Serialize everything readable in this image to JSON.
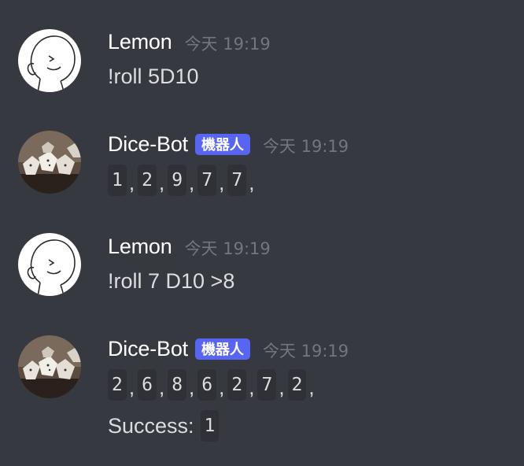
{
  "messages": [
    {
      "username": "Lemon",
      "timestamp": "今天 19:19",
      "content": "!roll 5D10",
      "avatar_icon": "sketch-face-avatar"
    },
    {
      "username": "Dice-Bot",
      "bot_tag": "機器人",
      "timestamp": "今天 19:19",
      "results": [
        "1",
        "2",
        "9",
        "7",
        "7"
      ],
      "separator": ",",
      "avatar_icon": "dice-avatar"
    },
    {
      "username": "Lemon",
      "timestamp": "今天 19:19",
      "content": "!roll 7 D10 >8",
      "avatar_icon": "sketch-face-avatar"
    },
    {
      "username": "Dice-Bot",
      "bot_tag": "機器人",
      "timestamp": "今天 19:19",
      "results": [
        "2",
        "6",
        "8",
        "6",
        "2",
        "7",
        "2"
      ],
      "separator": ",",
      "success_label": "Success:",
      "success_value": "1",
      "avatar_icon": "dice-avatar"
    }
  ],
  "colors": {
    "background": "#36393f",
    "code_background": "#2f3136",
    "bot_tag": "#5865f2",
    "username": "#ffffff",
    "timestamp": "#72767d",
    "text": "#dcddde"
  }
}
